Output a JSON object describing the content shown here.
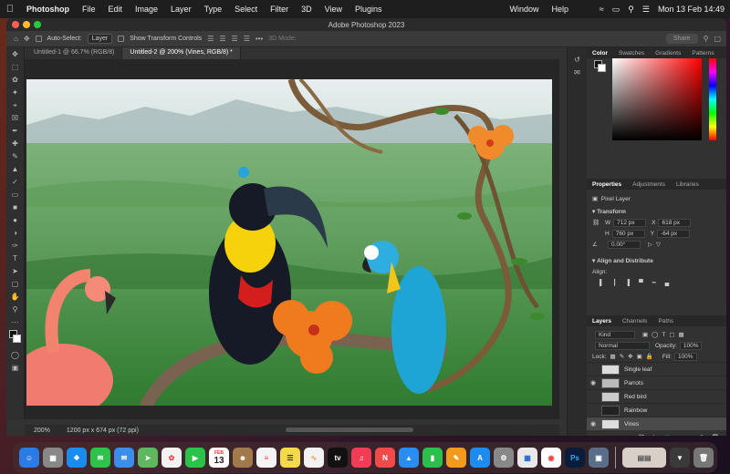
{
  "menubar": {
    "app": "Photoshop",
    "items": [
      "File",
      "Edit",
      "Image",
      "Layer",
      "Type",
      "Select",
      "Filter",
      "3D",
      "View",
      "Plugins"
    ],
    "right_items": [
      "Window",
      "Help"
    ],
    "datetime": "Mon 13 Feb  14:49"
  },
  "window": {
    "title": "Adobe Photoshop 2023"
  },
  "options": {
    "auto_select_label": "Auto-Select:",
    "auto_select_value": "Layer",
    "transform_controls_label": "Show Transform Controls",
    "mode_label": "3D Mode:",
    "share_label": "Share"
  },
  "tabs": [
    {
      "label": "Untitled-1 @ 66.7% (RGB/8)"
    },
    {
      "label": "Untitled-2 @ 200% (Vines, RGB/8) *"
    }
  ],
  "status": {
    "zoom": "200%",
    "info": "1200 px x 674 px (72 ppi)"
  },
  "color_panel": {
    "tabs": [
      "Color",
      "Swatches",
      "Gradients",
      "Patterns"
    ]
  },
  "properties_panel": {
    "tabs": [
      "Properties",
      "Adjustments",
      "Libraries"
    ],
    "kind": "Pixel Layer",
    "transform_label": "Transform",
    "w_label": "W",
    "w_value": "712 px",
    "x_label": "X",
    "x_value": "618 px",
    "h_label": "H",
    "h_value": "760 px",
    "y_label": "Y",
    "y_value": "-64 px",
    "angle_value": "0.00°",
    "align_section": "Align and Distribute",
    "align_label": "Align:"
  },
  "layers_panel": {
    "tabs": [
      "Layers",
      "Channels",
      "Paths"
    ],
    "filter": "Kind",
    "blend": "Normal",
    "opacity_label": "Opacity:",
    "opacity_value": "100%",
    "lock_label": "Lock:",
    "fill_label": "Fill:",
    "fill_value": "100%",
    "layers": [
      {
        "name": "Single leaf",
        "visible": false
      },
      {
        "name": "Parrots",
        "visible": true
      },
      {
        "name": "Red bird",
        "visible": false
      },
      {
        "name": "Rainbow",
        "visible": false
      },
      {
        "name": "Vines",
        "visible": true,
        "selected": true
      }
    ]
  },
  "dock": {
    "calendar_month": "FEB",
    "calendar_day": "13",
    "ps_label": "Ps"
  }
}
